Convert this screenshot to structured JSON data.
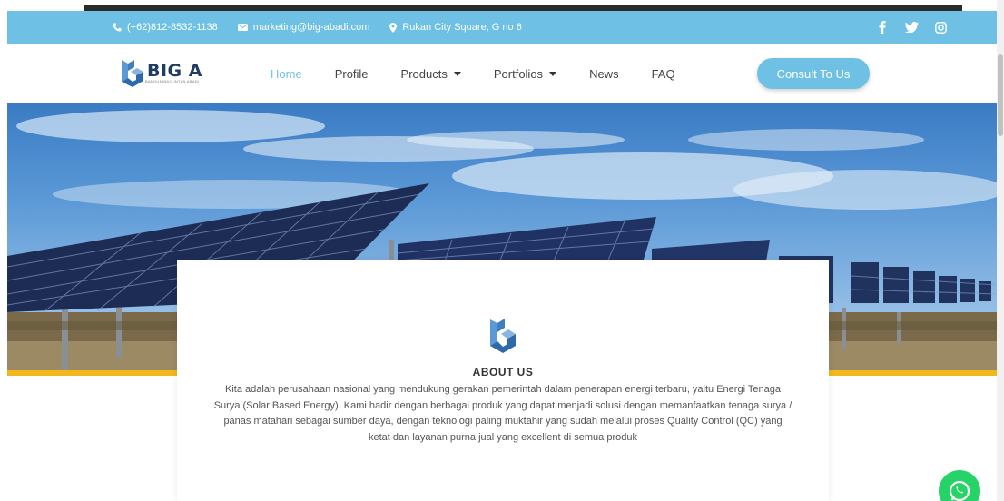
{
  "topbar": {
    "phone": "(+62)812-8532-1138",
    "email": "marketing@big-abadi.com",
    "address": "Rukan City Square, G no 6",
    "social_icons": [
      "facebook-icon",
      "twitter-icon",
      "instagram-icon"
    ]
  },
  "brand": {
    "name": "BIG A",
    "tagline": "BANGUNINDO INTAN ABADI"
  },
  "nav": {
    "items": [
      {
        "label": "Home",
        "active": true,
        "dropdown": false
      },
      {
        "label": "Profile",
        "active": false,
        "dropdown": false
      },
      {
        "label": "Products",
        "active": false,
        "dropdown": true
      },
      {
        "label": "Portfolios",
        "active": false,
        "dropdown": true
      },
      {
        "label": "News",
        "active": false,
        "dropdown": false
      },
      {
        "label": "FAQ",
        "active": false,
        "dropdown": false
      }
    ],
    "cta_label": "Consult To Us"
  },
  "about": {
    "title": "ABOUT US",
    "text": "Kita adalah perusahaan nasional yang mendukung gerakan pemerintah dalam penerapan energi terbaru, yaitu Energi Tenaga Surya (Solar Based Energy). Kami hadir dengan berbagai produk yang dapat menjadi solusi dengan memanfaatkan tenaga surya / panas matahari sebagai sumber daya, dengan teknologi paling muktahir yang sudah melalui proses Quality Control (QC) yang ketat dan layanan purna jual yang excellent di semua produk"
  },
  "colors": {
    "accent": "#6ec1e4",
    "brand_dark": "#1f3d63",
    "hero_stripe": "#f2b71c",
    "whatsapp": "#25d366"
  }
}
